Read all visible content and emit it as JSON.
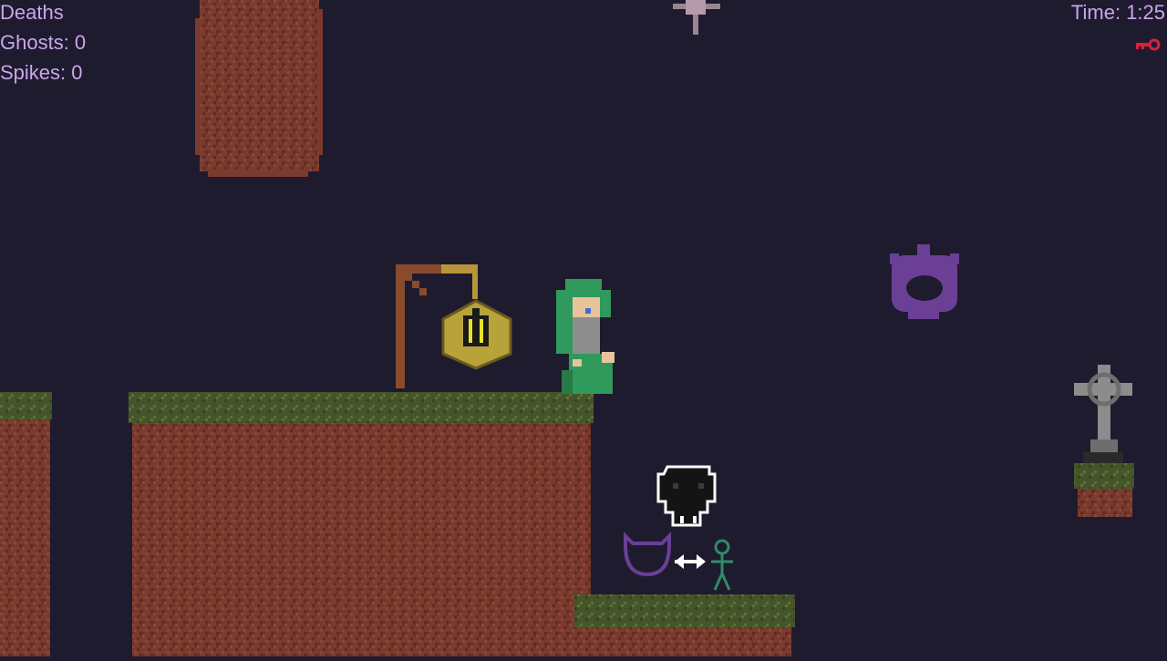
{
  "hud": {
    "deaths_label": "Deaths",
    "ghosts_label": "Ghosts: 0",
    "spikes_label": "Spikes: 0",
    "time_label": "Time: 1:25"
  },
  "inventory": {
    "key_icon": "key-icon",
    "key_color": "#d8213b"
  },
  "colors": {
    "background": "#1f1b2e",
    "dirt": "#7d3b2e",
    "dirt_dark": "#5e2a22",
    "grass": "#4a5d2c",
    "grass_light": "#6b7a33",
    "hud_text": "#c9a6ee",
    "player_robe": "#2f9a5b",
    "ghost_purple": "#6b3f96",
    "stick_figure": "#2f8b6b",
    "lantern": "#b8a33a"
  },
  "entities": [
    "player-wizard",
    "lantern-post",
    "purple-ghost-enemy",
    "celtic-cross-tombstone",
    "ceiling-spike",
    "skull-hint-icon",
    "ghost-swap-hint"
  ]
}
